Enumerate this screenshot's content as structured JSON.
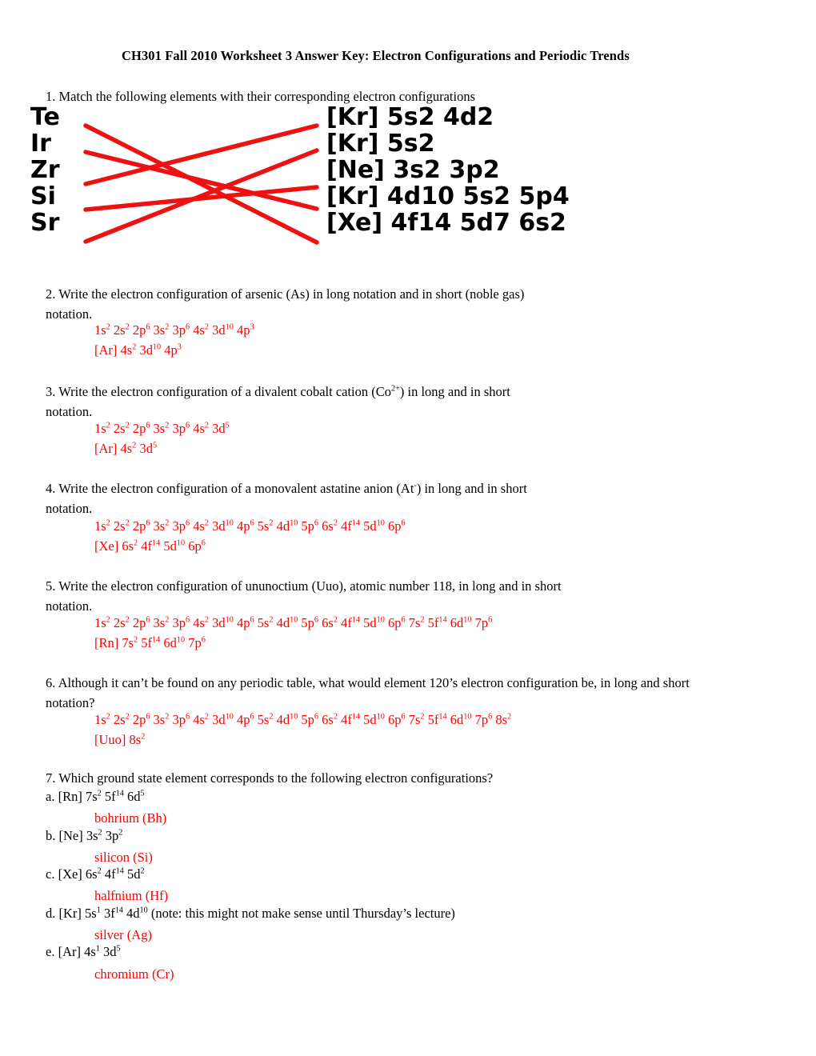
{
  "document": {
    "title": "CH301 Fall 2010 Worksheet 3 Answer Key: Electron Configurations and Periodic Trends"
  },
  "q1": {
    "prompt": "1. Match the following elements with their corresponding electron configurations",
    "elements": [
      "Te",
      "Ir",
      "Zr",
      "Si",
      "Sr"
    ],
    "configurations": [
      "[Kr] 5s2 4d2",
      "[Kr] 5s2",
      "[Ne] 3s2 3p2",
      "[Kr] 4d10 5s2 5p4",
      "[Xe] 4f14 5d7 6s2"
    ],
    "matches": [
      {
        "left_index": 0,
        "right_index": 4
      },
      {
        "left_index": 1,
        "right_index": 3
      },
      {
        "left_index": 2,
        "right_index": 0
      },
      {
        "left_index": 3,
        "right_index": 2
      },
      {
        "left_index": 4,
        "right_index": 1
      }
    ],
    "line_color": "#ee1111"
  },
  "q2": {
    "prompt_line1": "2. Write the electron configuration of arsenic (As) in long notation and in short (noble gas)",
    "prompt_line2": "notation.",
    "answer_long": "1s2 2s2 2p6 3s2 3p6 4s2 3d10 4p3",
    "answer_short": "[Ar] 4s2 3d10 4p3"
  },
  "q3": {
    "prompt_line1": "3. Write the electron configuration of a divalent cobalt cation (Co2+) in long and in short",
    "prompt_line2": "notation.",
    "answer_long": "1s2 2s2 2p6 3s2 3p6 4s2 3d5",
    "answer_short": "[Ar] 4s2 3d5"
  },
  "q4": {
    "prompt_line1": "4. Write the electron configuration of a monovalent astatine anion (At-) in long and in short",
    "prompt_line2": "notation.",
    "answer_long": "1s2 2s2 2p6 3s2 3p6 4s2 3d10 4p6 5s2 4d10 5p6 6s2 4f14 5d10 6p6",
    "answer_short": "[Xe] 6s2 4f14 5d10 6p6"
  },
  "q5": {
    "prompt_line1": "5. Write the electron configuration of ununoctium (Uuo), atomic number 118, in long and in short",
    "prompt_line2": "notation.",
    "answer_long": "1s2 2s2 2p6 3s2 3p6 4s2 3d10 4p6 5s2 4d10 5p6 6s2 4f14 5d10 6p6 7s2 5f14 6d10 7p6",
    "answer_short": "[Rn] 7s2 5f14 6d10 7p6"
  },
  "q6": {
    "prompt_line1": "6. Although it can’t be found on any periodic table, what would element 120’s electron configuration be, in long and short",
    "prompt_line2": "notation?",
    "answer_long": "1s2 2s2 2p6 3s2 3p6 4s2 3d10 4p6 5s2 4d10 5p6 6s2 4f14 5d10 6p6 7s2 5f14 6d10 7p6 8s2",
    "answer_short": "[Uuo] 8s2"
  },
  "q7": {
    "prompt": "7. Which ground state element corresponds to the following electron configurations?",
    "items": [
      {
        "label": "a. [Rn] 7s2 5f14 6d5",
        "answer": "bohrium (Bh)"
      },
      {
        "label": "b. [Ne] 3s2 3p2",
        "answer": "silicon (Si)"
      },
      {
        "label": "c. [Xe] 6s2 4f14 5d2",
        "answer": "halfnium (Hf)"
      },
      {
        "label": "d. [Kr] 5s1 3f14 4d10 (note: this might not make sense until Thursday’s lecture)",
        "answer": "silver (Ag)"
      },
      {
        "label": "e. [Ar] 4s1 3d5",
        "answer": "chromium (Cr)"
      }
    ]
  }
}
